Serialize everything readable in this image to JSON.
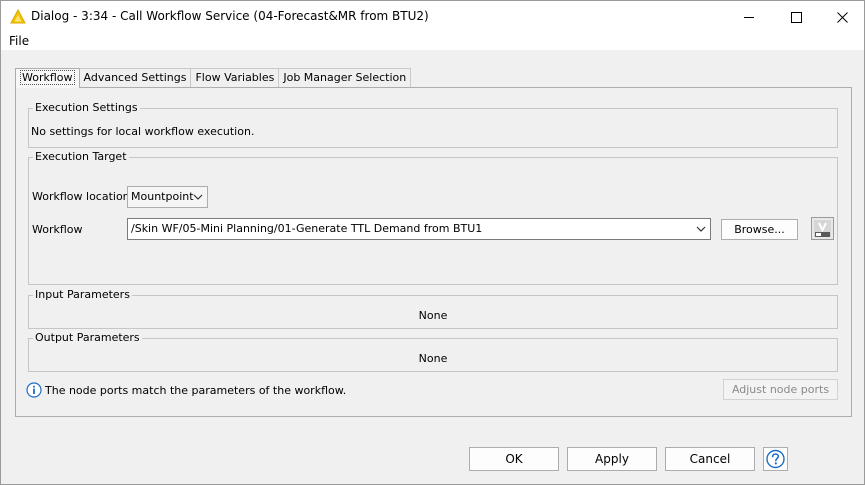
{
  "window": {
    "title": "Dialog - 3:34 - Call Workflow Service (04-Forecast&MR from BTU2)"
  },
  "menu": {
    "file": "File"
  },
  "tabs": [
    {
      "label": "Workflow",
      "active": true
    },
    {
      "label": "Advanced Settings"
    },
    {
      "label": "Flow Variables"
    },
    {
      "label": "Job Manager Selection"
    }
  ],
  "execution_settings": {
    "title": "Execution Settings",
    "message": "No settings for local workflow execution."
  },
  "execution_target": {
    "title": "Execution Target",
    "location_label": "Workflow location",
    "location_value": "Mountpoint",
    "workflow_label": "Workflow",
    "workflow_value": "/Skin WF/05-Mini Planning/01-Generate TTL Demand from BTU1",
    "browse_label": "Browse..."
  },
  "input_parameters": {
    "title": "Input Parameters",
    "value": "None"
  },
  "output_parameters": {
    "title": "Output Parameters",
    "value": "None"
  },
  "info": {
    "message": "The node ports match the parameters of the workflow.",
    "adjust_label": "Adjust node ports"
  },
  "footer": {
    "ok": "OK",
    "apply": "Apply",
    "cancel": "Cancel"
  },
  "colors": {
    "accent": "#0067c0",
    "warning_icon": "#f5c400"
  }
}
